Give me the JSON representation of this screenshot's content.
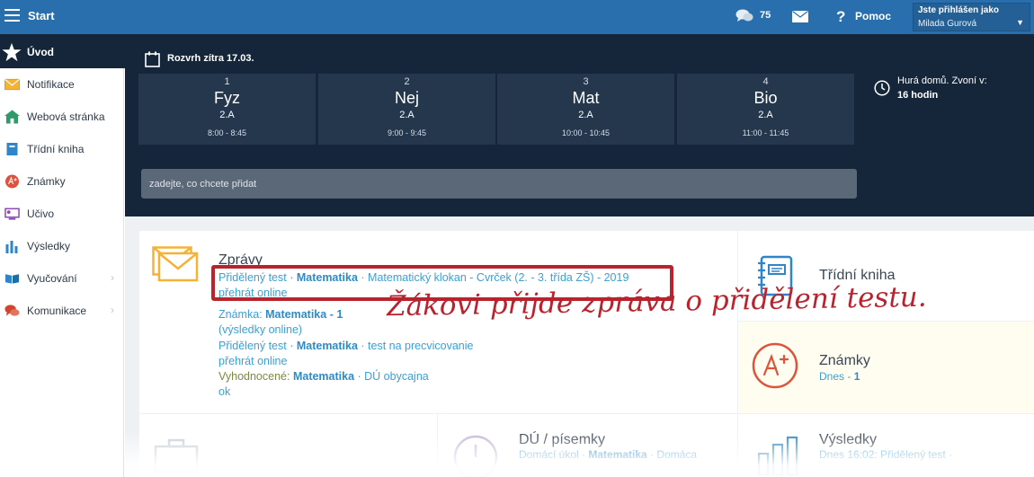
{
  "topbar": {
    "app_title": "Start",
    "message_count": "75",
    "help_label": "Pomoc",
    "help_glyph": "?",
    "user_caption": "Jste přihlášen jako",
    "user_name": "Milada Gurová",
    "user_chevron": "▼"
  },
  "sidebar": {
    "items": [
      {
        "label": "Úvod",
        "icon": "star-icon",
        "color": "#ffffff"
      },
      {
        "label": "Notifikace",
        "icon": "envelope-icon",
        "color": "#f3a21c"
      },
      {
        "label": "Webová stránka",
        "icon": "house-icon",
        "color": "#2f9a6b"
      },
      {
        "label": "Třídní kniha",
        "icon": "book-icon",
        "color": "#2e86c9"
      },
      {
        "label": "Známky",
        "icon": "grade-icon",
        "color": "#e0533a"
      },
      {
        "label": "Učivo",
        "icon": "monitor-icon",
        "color": "#8a4bb3"
      },
      {
        "label": "Výsledky",
        "icon": "bar-chart-icon",
        "color": "#2e86c9"
      },
      {
        "label": "Vyučování",
        "icon": "open-book-icon",
        "color": "#2e86c9"
      },
      {
        "label": "Komunikace",
        "icon": "chat-icon",
        "color": "#d0452e"
      }
    ],
    "arrow": "›"
  },
  "schedule": {
    "title": "Rozvrh zítra 17.03.",
    "lessons": [
      {
        "num": "1",
        "subject": "Fyz",
        "class": "2.A",
        "time": "8:00 - 8:45"
      },
      {
        "num": "2",
        "subject": "Nej",
        "class": "2.A",
        "time": "9:00 - 9:45"
      },
      {
        "num": "3",
        "subject": "Mat",
        "class": "2.A",
        "time": "10:00 - 10:45"
      },
      {
        "num": "4",
        "subject": "Bio",
        "class": "2.A",
        "time": "11:00 - 11:45"
      }
    ],
    "bell_text": "Hurá domů. Zvoní v:",
    "bell_time": "16 hodin",
    "add_placeholder": "zadejte, co chcete přidat"
  },
  "messages": {
    "title": "Zprávy",
    "entries": [
      {
        "type": "Přidělený test",
        "subject": "Matematika",
        "detail": "Matematický klokan - Cvrček (2. - 3. třída ZŠ) - 2019",
        "sub": "přehrát online"
      },
      {
        "type": "Známka:",
        "subject": "Matematika",
        "detail": "1",
        "sub": "(výsledky online)"
      },
      {
        "type": "Přidělený test",
        "subject": "Matematika",
        "detail": "test na precvicovanie",
        "sub": "přehrát online"
      },
      {
        "type": "Vyhodnocené:",
        "subject": "Matematika",
        "detail": "DÚ obycajna",
        "sub": "ok"
      }
    ],
    "sep": " · "
  },
  "cards": {
    "tridni_kniha": "Třídní kniha",
    "znamky_title": "Známky",
    "znamky_sub_prefix": "Dnes - ",
    "znamky_sub_value": "1",
    "du_title": "DÚ / písemky",
    "du_sub_prefix": "Domácí úkol · ",
    "du_sub_subject": "Matematika",
    "du_sub_suffix": " · Domáca",
    "vysledky_title": "Výsledky",
    "vysledky_sub": "Dnes 16:02: Přidělený test ·"
  },
  "annotation": {
    "text": "Žákovi přijde zpráva o přidělení testu.",
    "color": "#b8232e"
  }
}
